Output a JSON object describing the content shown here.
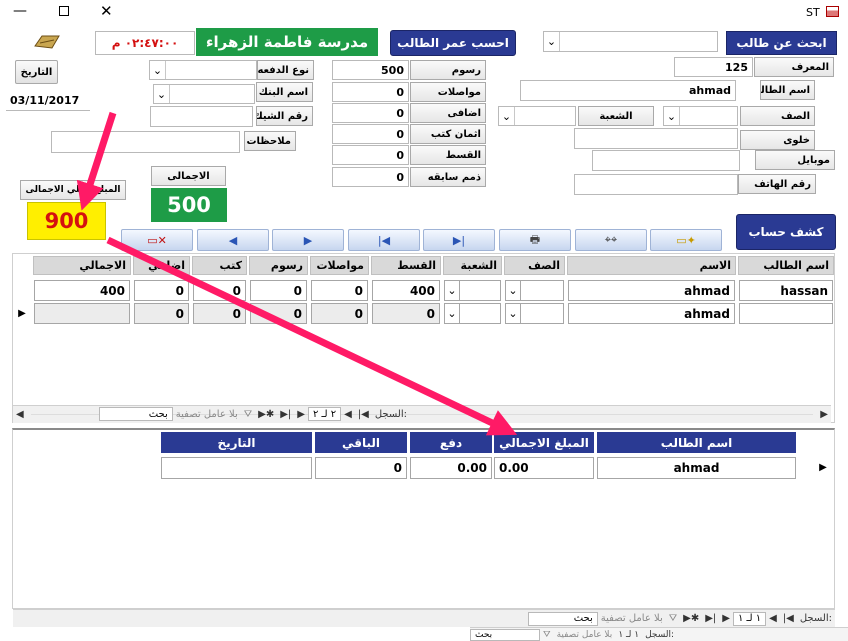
{
  "window": {
    "title": "ST"
  },
  "top": {
    "school_name": "مدرسة فاطمة الزهراء",
    "clock": "٠٢:٤٧:٠٠ م",
    "calc_age_button": "احسب عمر الطالب",
    "search_student_button": "ابحث عن طالب",
    "search_value": ""
  },
  "left_form": {
    "date_button": "التاريخ",
    "date_value": "03/11/2017",
    "payment_type_label": "نوع الدفعه",
    "payment_type_value": "",
    "bank_name_label": "اسم البنك",
    "bank_name_value": "",
    "check_no_label": "رقم الشيك",
    "check_no_value": "",
    "notes_label": "ملاحظات",
    "notes_value": "",
    "total_label": "الاجمالى",
    "total_value": "500",
    "grand_total_label": "المبلغ الكلي الاجمالى",
    "grand_total_value": "900"
  },
  "fees": {
    "items": [
      {
        "label": "رسوم",
        "value": "500"
      },
      {
        "label": "مواصلات",
        "value": "0"
      },
      {
        "label": "اضافى",
        "value": "0"
      },
      {
        "label": "اثمان كتب",
        "value": "0"
      },
      {
        "label": "القسط",
        "value": "0"
      },
      {
        "label": "ذمم سابقه",
        "value": "0"
      }
    ]
  },
  "student": {
    "id_label": "المعرف",
    "id_value": "125",
    "name_label": "اسم الطالب",
    "name_value": "ahmad",
    "class_label": "الصف",
    "class_value": "",
    "section_label": "الشعبة",
    "section_value": "",
    "landline_label": "خلوى",
    "landline_value": "",
    "mobile_label": "موبايل",
    "mobile_value": "",
    "phone_label": "رقم الهاتف",
    "phone_value": "",
    "statement_button": "كشف حساب"
  },
  "grid1": {
    "headers": [
      "اسم الطالب",
      "الاسم",
      "الصف",
      "الشعبة",
      "القسط",
      "مواصلات",
      "رسوم",
      "كتب",
      "اضافي",
      "الاجمالي"
    ],
    "rows": [
      {
        "student": "hassan",
        "name": "ahmad",
        "class": "",
        "section": "",
        "installment": "400",
        "transport": "0",
        "fees": "0",
        "books": "0",
        "extra": "0",
        "total": "400"
      },
      {
        "student": "",
        "name": "ahmad",
        "class": "",
        "section": "",
        "installment": "0",
        "transport": "0",
        "fees": "0",
        "books": "0",
        "extra": "0",
        "total": ""
      }
    ],
    "nav": {
      "record_label": "السجل:",
      "position": "٢ لـ ٢",
      "filter": "بلا عامل تصفية",
      "search": "بحث"
    }
  },
  "grid2": {
    "headers": [
      "اسم الطالب",
      "المبلغ الاجمالي",
      "دفع",
      "الباقي",
      "التاريخ"
    ],
    "row": {
      "student": "ahmad",
      "total": "0.00",
      "paid": "0.00",
      "remaining": "0",
      "date": ""
    },
    "nav": {
      "record_label": "السجل:",
      "position": "١ لـ ١",
      "filter": "بلا عامل تصفية",
      "search": "بحث"
    }
  },
  "bottom_bar": {
    "record_label": "السجل:",
    "position": "١ لـ ١",
    "filter": "بلا عامل تصفية",
    "search": "بحث"
  },
  "colors": {
    "accent_navy": "#2a3a93",
    "green": "#1e9c47",
    "yellow": "#ffef00",
    "red_text": "#d41010",
    "arrow": "#ff1a66"
  }
}
